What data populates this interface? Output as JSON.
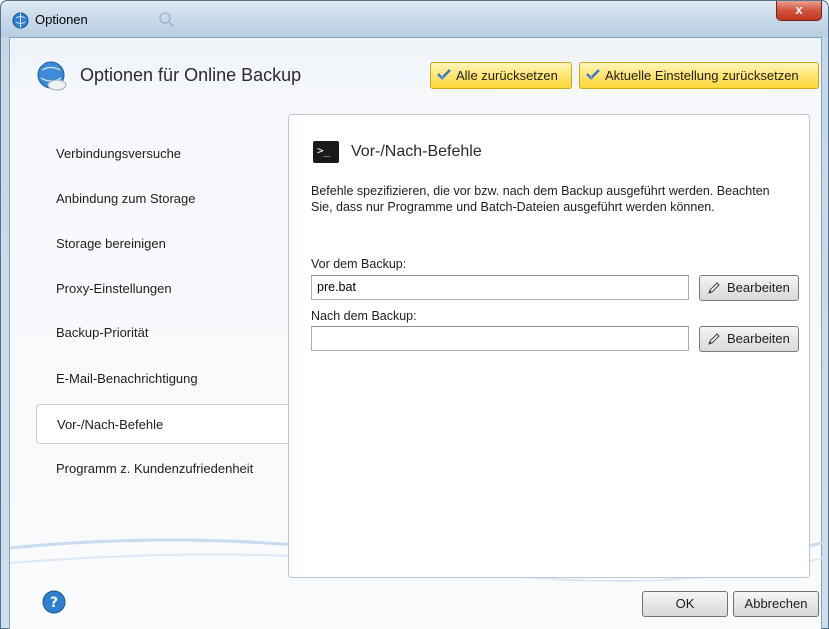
{
  "window": {
    "title": "Optionen",
    "close_label": "x"
  },
  "header": {
    "title": "Optionen für Online Backup",
    "reset_all_label": "Alle zurücksetzen",
    "reset_current_label": "Aktuelle Einstellung zurücksetzen"
  },
  "sidebar": {
    "items": [
      {
        "label": "Verbindungsversuche"
      },
      {
        "label": "Anbindung zum Storage"
      },
      {
        "label": "Storage bereinigen"
      },
      {
        "label": "Proxy-Einstellungen"
      },
      {
        "label": "Backup-Priorität"
      },
      {
        "label": "E-Mail-Benachrichtigung"
      },
      {
        "label": "Vor-/Nach-Befehle"
      },
      {
        "label": "Programm z. Kundenzufriedenheit"
      }
    ],
    "active_index": 6
  },
  "panel": {
    "title": "Vor-/Nach-Befehle",
    "description": "Befehle spezifizieren, die vor bzw. nach dem Backup ausgeführt werden. Beachten Sie, dass nur Programme und Batch-Dateien ausgeführt werden können.",
    "pre_label": "Vor dem Backup:",
    "pre_value": "pre.bat",
    "post_label": "Nach dem Backup:",
    "post_value": "",
    "edit_label": "Bearbeiten"
  },
  "footer": {
    "ok_label": "OK",
    "cancel_label": "Abbrechen"
  },
  "colors": {
    "accent_yellow": "#ffe46b",
    "close_red": "#d2543c",
    "frame_blue": "#b9cde2"
  }
}
